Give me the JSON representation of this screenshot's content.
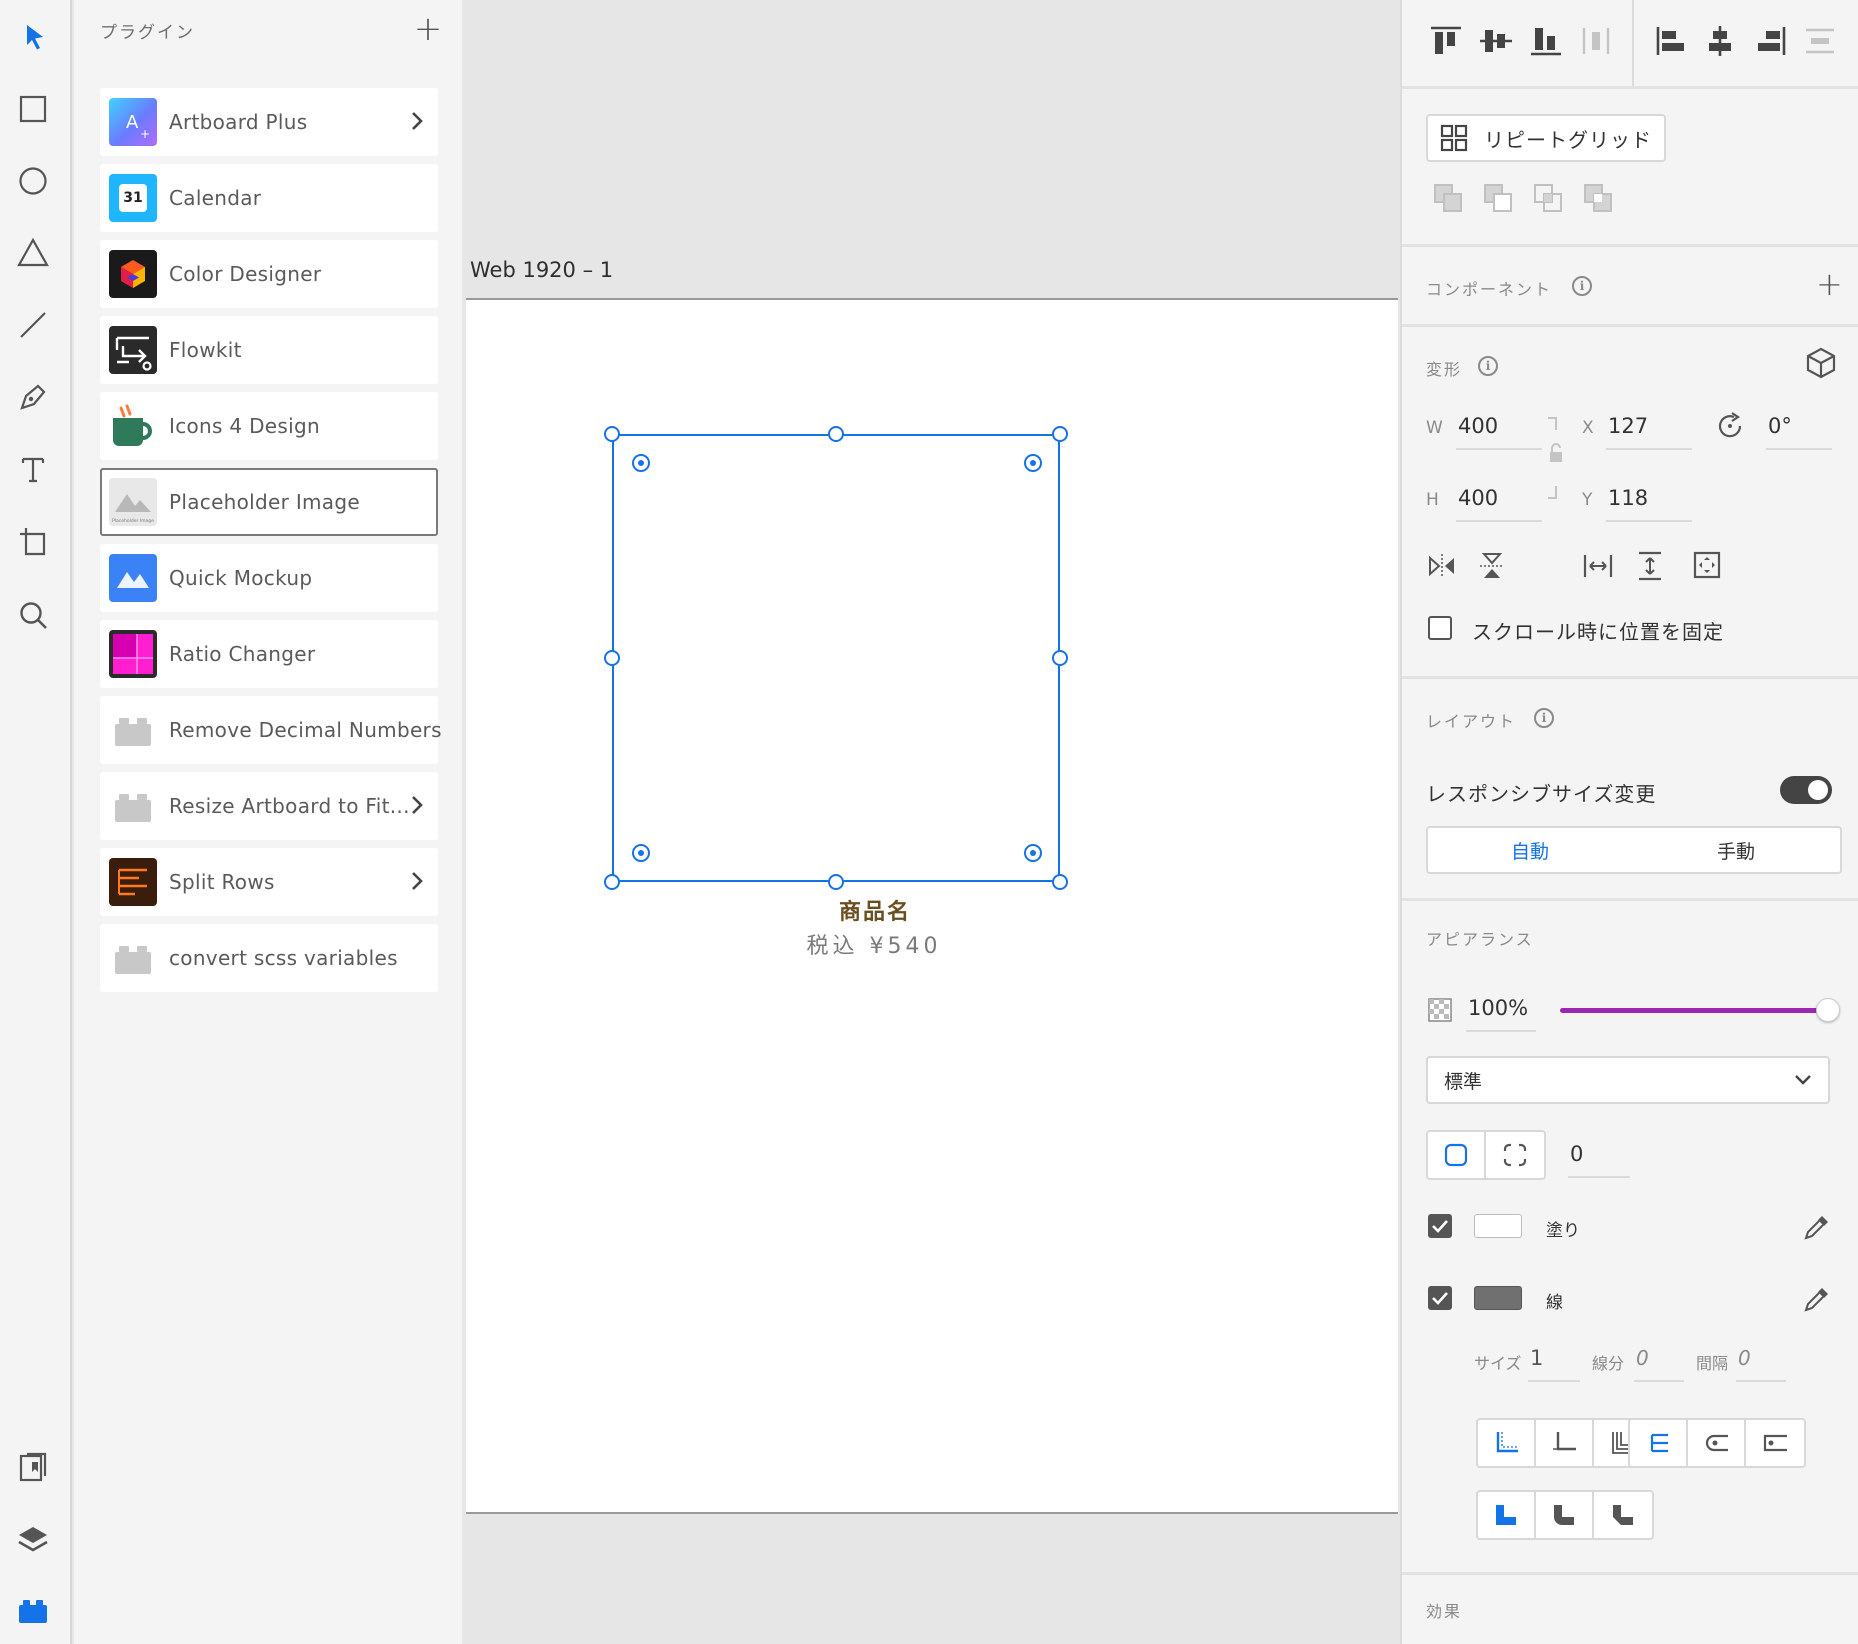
{
  "colors": {
    "accent": "#1473e6",
    "slider": "#9c27b0",
    "product_name": "#6b4e1f"
  },
  "toolbar": {
    "tools": [
      "select-icon",
      "rectangle-icon",
      "ellipse-icon",
      "triangle-icon",
      "line-icon",
      "pen-icon",
      "text-icon",
      "artboard-icon",
      "zoom-icon"
    ],
    "bottom": [
      "document-assets-icon",
      "layers-icon",
      "plugins-icon"
    ]
  },
  "plugins": {
    "title": "プラグイン",
    "add_label": "+",
    "items": [
      {
        "label": "Artboard Plus",
        "icon": "artboard-plus-icon"
      },
      {
        "label": "Calendar",
        "icon": "calendar-icon"
      },
      {
        "label": "Color Designer",
        "icon": "color-designer-icon"
      },
      {
        "label": "Flowkit",
        "icon": "flowkit-icon"
      },
      {
        "label": "Icons 4 Design",
        "icon": "icons4design-icon"
      },
      {
        "label": "Placeholder Image",
        "icon": "placeholder-image-icon"
      },
      {
        "label": "Quick Mockup",
        "icon": "quick-mockup-icon"
      },
      {
        "label": "Ratio Changer",
        "icon": "ratio-changer-icon"
      },
      {
        "label": "Remove Decimal Numbers",
        "icon": "generic-plugin-icon"
      },
      {
        "label": "Resize Artboard to Fit...",
        "icon": "generic-plugin-icon"
      },
      {
        "label": "Split Rows",
        "icon": "split-rows-icon"
      },
      {
        "label": "convert scss variables",
        "icon": "generic-plugin-icon"
      }
    ],
    "calendar_day": "31",
    "placeholder_caption": "Placeholder Image"
  },
  "canvas": {
    "artboard_title": "Web 1920 – 1",
    "product_name": "商品名",
    "product_price": "税込 ¥540"
  },
  "props": {
    "repeat_grid": "リピートグリッド",
    "component_title": "コンポーネント",
    "transform_title": "変形",
    "w_label": "W",
    "w_value": "400",
    "h_label": "H",
    "h_value": "400",
    "x_label": "X",
    "x_value": "127",
    "y_label": "Y",
    "y_value": "118",
    "rotation_value": "0°",
    "fix_scroll_label": "スクロール時に位置を固定",
    "layout_title": "レイアウト",
    "responsive_label": "レスポンシブサイズ変更",
    "responsive_on": true,
    "auto_label": "自動",
    "manual_label": "手動",
    "appearance_title": "アピアランス",
    "opacity_value": "100%",
    "opacity_fraction": 1.0,
    "blend_mode": "標準",
    "corner_radius": "0",
    "fill_label": "塗り",
    "stroke_label": "線",
    "fill_checked": true,
    "stroke_checked": true,
    "size_label": "サイズ",
    "size_value": "1",
    "dash_label": "線分",
    "dash_value": "0",
    "gap_label": "間隔",
    "gap_value": "0",
    "effects_title": "効果"
  }
}
